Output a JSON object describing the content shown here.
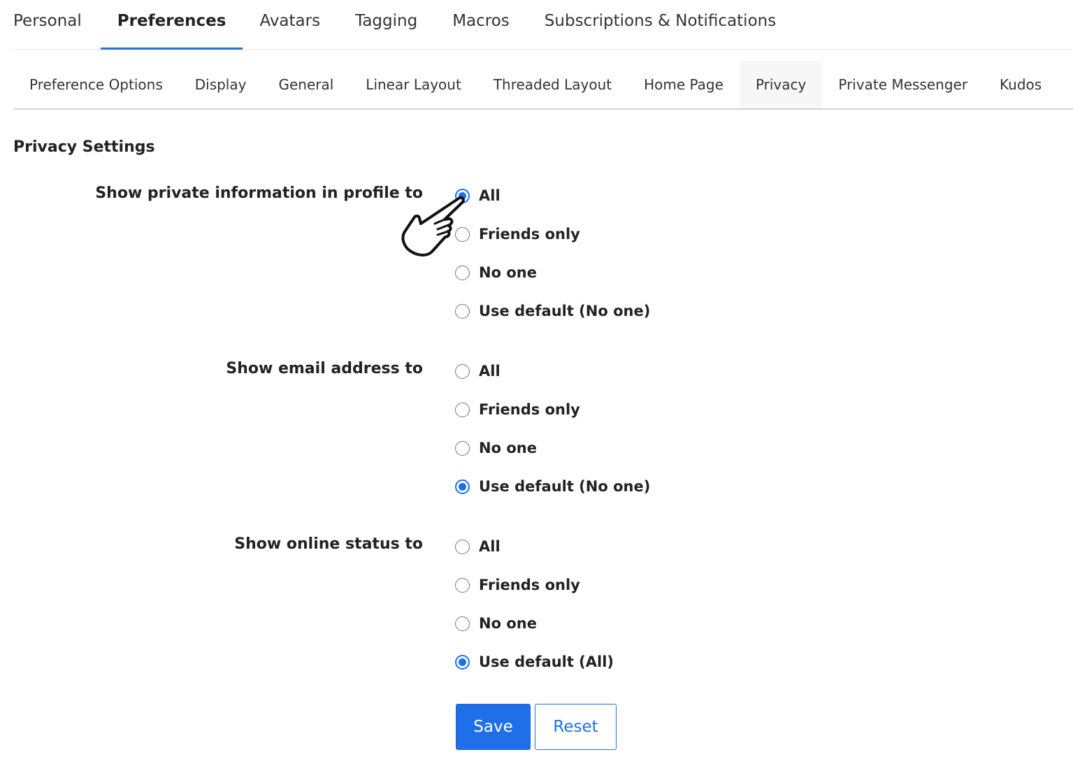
{
  "top_tabs": [
    {
      "label": "Personal",
      "active": false
    },
    {
      "label": "Preferences",
      "active": true
    },
    {
      "label": "Avatars",
      "active": false
    },
    {
      "label": "Tagging",
      "active": false
    },
    {
      "label": "Macros",
      "active": false
    },
    {
      "label": "Subscriptions & Notifications",
      "active": false
    }
  ],
  "sub_tabs": [
    {
      "label": "Preference Options",
      "active": false
    },
    {
      "label": "Display",
      "active": false
    },
    {
      "label": "General",
      "active": false
    },
    {
      "label": "Linear Layout",
      "active": false
    },
    {
      "label": "Threaded Layout",
      "active": false
    },
    {
      "label": "Home Page",
      "active": false
    },
    {
      "label": "Privacy",
      "active": true
    },
    {
      "label": "Private Messenger",
      "active": false
    },
    {
      "label": "Kudos",
      "active": false
    }
  ],
  "section": {
    "title": "Privacy Settings",
    "settings": [
      {
        "label": "Show private information in profile to",
        "options": [
          "All",
          "Friends only",
          "No one",
          "Use default (No one)"
        ],
        "selected": "All"
      },
      {
        "label": "Show email address to",
        "options": [
          "All",
          "Friends only",
          "No one",
          "Use default (No one)"
        ],
        "selected": "Use default (No one)"
      },
      {
        "label": "Show online status to",
        "options": [
          "All",
          "Friends only",
          "No one",
          "Use default (All)"
        ],
        "selected": "Use default (All)"
      }
    ]
  },
  "buttons": {
    "save_label": "Save",
    "reset_label": "Reset"
  },
  "colors": {
    "accent": "#1e6fe8",
    "text": "#222222",
    "divider": "#d4d4d4"
  },
  "cursor": {
    "icon": "hand-pointer-icon"
  }
}
